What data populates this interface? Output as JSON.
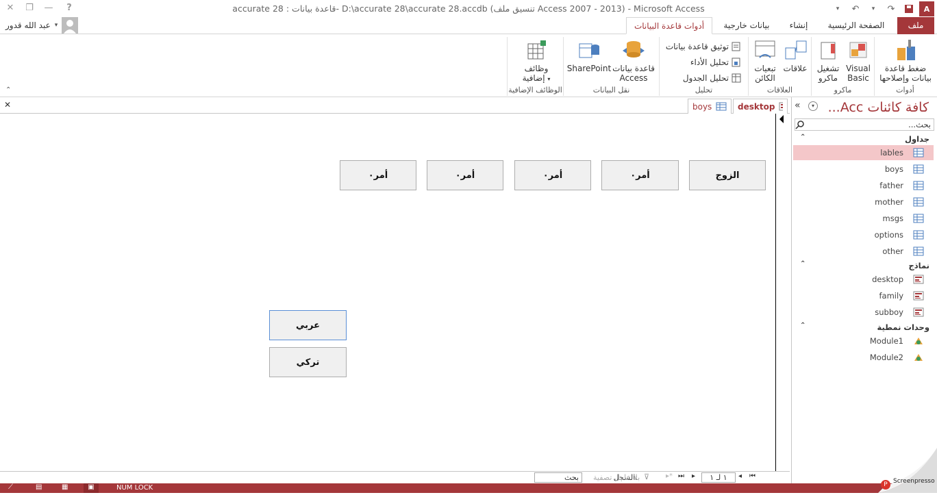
{
  "window": {
    "title": "accurate 28 : قاعدة بيانات- D:\\accurate 28\\accurate 28.accdb (تنسيق ملف Access 2007 - 2013) - Microsoft Access"
  },
  "user": {
    "name": "عبد الله قدور"
  },
  "tabs": {
    "file": "ملف",
    "home": "الصفحة الرئيسية",
    "create": "إنشاء",
    "external": "بيانات خارجية",
    "dbtools": "أدوات قاعدة البيانات"
  },
  "ribbon": {
    "tools": {
      "label": "أدوات",
      "compact_line1": "ضغط قاعدة",
      "compact_line2": "بيانات وإصلاحها"
    },
    "macro": {
      "label": "ماكرو",
      "vb_line1": "Visual",
      "vb_line2": "Basic",
      "run_line1": "تشغيل",
      "run_line2": "ماكرو"
    },
    "relationships": {
      "label": "العلاقات",
      "rel": "علاقات",
      "dep_line1": "تبعيات",
      "dep_line2": "الكائن"
    },
    "analyze": {
      "label": "تحليل",
      "doc": "توثيق قاعدة بيانات",
      "perf": "تحليل الأداء",
      "table": "تحليل الجدول"
    },
    "move": {
      "label": "نقل البيانات",
      "access_line1": "قاعدة بيانات",
      "access_line2": "Access",
      "sharepoint": "SharePoint"
    },
    "addins": {
      "label": "الوظائف الإضافية",
      "addin_line1": "وظائف",
      "addin_line2": "إضافية"
    }
  },
  "doc_tabs": {
    "desktop": "desktop",
    "boys": "boys"
  },
  "form": {
    "top_buttons": [
      "الزوج",
      "أمر٠",
      "أمر٠",
      "أمر٠",
      "أمر٠"
    ],
    "arabic_button": "عربي",
    "turkish_button": "تركي"
  },
  "nav": {
    "title": "كافة كائنات Acc...",
    "search_placeholder": "بحث...",
    "tables_header": "جداول",
    "tables": [
      "lables",
      "boys",
      "father",
      "mother",
      "msgs",
      "options",
      "other"
    ],
    "forms_header": "نماذج",
    "forms": [
      "desktop",
      "family",
      "subboy"
    ],
    "modules_header": "وحدات نمطية",
    "modules": [
      "Module1",
      "Module2"
    ]
  },
  "record_bar": {
    "label": "السجل:",
    "position": "١ لـ ١",
    "filter": "بلا عامل تصفية",
    "search": "بحث"
  },
  "status": {
    "numlock": "NUM LOCK"
  },
  "watermark": "Screenpresso",
  "colors": {
    "accent": "#a4373a",
    "selection": "#f4c7c9"
  }
}
